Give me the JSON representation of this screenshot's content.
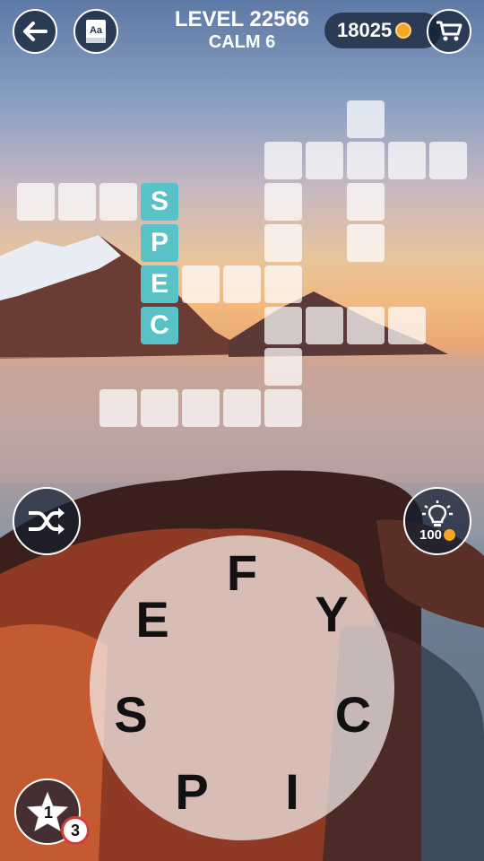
{
  "header": {
    "level": "LEVEL 22566",
    "pack": "CALM 6",
    "coins": "18025"
  },
  "grid": {
    "revealed": [
      "S",
      "P",
      "E",
      "C"
    ]
  },
  "hint": {
    "cost": "100"
  },
  "wheel": {
    "letters": [
      "F",
      "Y",
      "C",
      "I",
      "P",
      "S",
      "E"
    ]
  },
  "star": {
    "stars": "1",
    "badge": "3"
  },
  "icons": {
    "back": "back-arrow-icon",
    "dictionary": "dictionary-icon",
    "shop": "shopping-cart-icon",
    "shuffle": "shuffle-icon",
    "hint": "lightbulb-icon",
    "coin": "coin-icon",
    "star": "star-icon"
  }
}
